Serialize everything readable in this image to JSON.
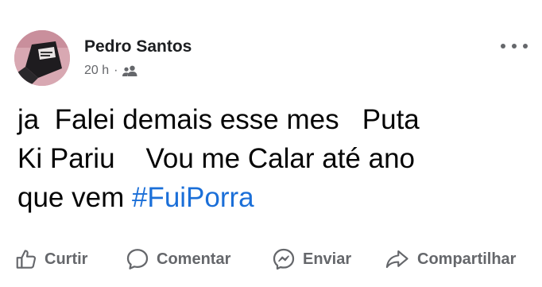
{
  "post": {
    "author": "Pedro Santos",
    "time": "20 h",
    "separator": "·",
    "audience_icon": "friends-icon",
    "menu_icon": "more-icon",
    "text_lines": [
      "ja  Falei demais esse mes   Puta",
      "Ki Pariu    Vou me Calar até ano",
      "que vem "
    ],
    "hashtag": "#FuiPorra"
  },
  "actions": {
    "like": {
      "label": "Curtir",
      "icon": "like-icon"
    },
    "comment": {
      "label": "Comentar",
      "icon": "comment-icon"
    },
    "send": {
      "label": "Enviar",
      "icon": "messenger-icon"
    },
    "share": {
      "label": "Compartilhar",
      "icon": "share-icon"
    }
  },
  "colors": {
    "hashtag": "#1b6fd8",
    "secondary_text": "#65676b",
    "author": "#1c1e21"
  }
}
